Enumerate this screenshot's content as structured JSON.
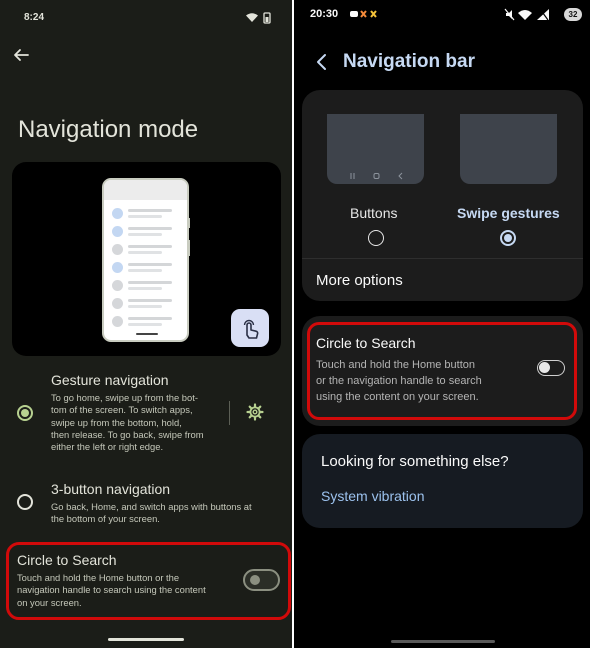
{
  "left_screen": {
    "status_time": "8:24",
    "page_title": "Navigation mode",
    "options": [
      {
        "title": "Gesture navigation",
        "description": "To go home, swipe up from the bot-\ntom of the screen. To switch apps,\nswipe up from the bottom, hold,\nthen release. To go back, swipe from\neither the left or right edge.",
        "selected": true
      },
      {
        "title": "3-button navigation",
        "description": "Go back, Home, and switch apps with buttons at\nthe bottom of your screen.",
        "selected": false
      }
    ],
    "circle_to_search": {
      "title": "Circle to Search",
      "description": "Touch and hold the Home button or the\nnavigation handle to search using the content\non your screen.",
      "enabled": false
    },
    "accent_color": "#b7d190",
    "highlight_color": "#d10a0a"
  },
  "right_screen": {
    "status_time": "20:30",
    "battery": "32",
    "page_title": "Navigation bar",
    "nav_types": [
      {
        "label": "Buttons",
        "selected": false
      },
      {
        "label": "Swipe gestures",
        "selected": true
      }
    ],
    "more_options": "More options",
    "circle_to_search": {
      "title": "Circle to Search",
      "description": "Touch and hold the Home button\nor the navigation handle to search\nusing the content on your screen.",
      "enabled": false
    },
    "looking_title": "Looking for something else?",
    "looking_link": "System vibration",
    "accent_color": "#c6d9f3",
    "highlight_color": "#d10a0a"
  }
}
